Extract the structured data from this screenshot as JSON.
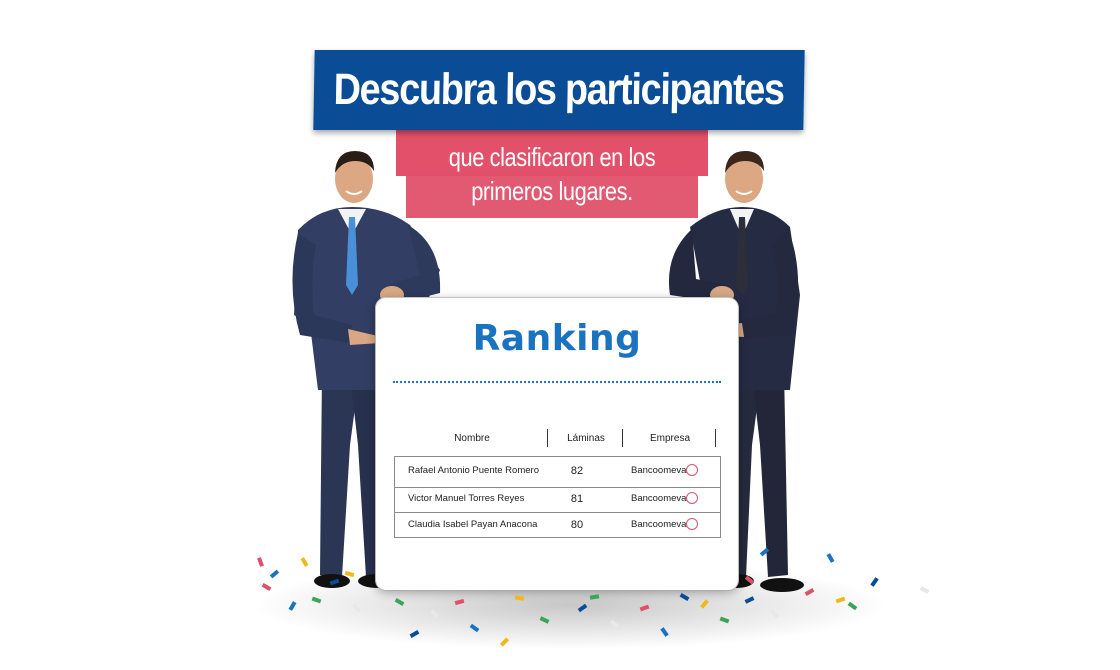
{
  "headline": {
    "title": "Descubra los participantes",
    "subtitle_line1": "que clasificaron en los",
    "subtitle_line2": "primeros lugares."
  },
  "board": {
    "title": "Ranking",
    "columns": [
      "Nombre",
      "Láminas",
      "Empresa"
    ],
    "rows": [
      {
        "name": "Rafael Antonio Puente Romero",
        "laminas": "82",
        "empresa": "Bancoomeva"
      },
      {
        "name": "Victor Manuel Torres Reyes",
        "laminas": "81",
        "empresa": "Bancoomeva"
      },
      {
        "name": "Claudia Isabel Payan Anacona",
        "laminas": "80",
        "empresa": "Bancoomeva"
      }
    ]
  },
  "colors": {
    "blue_banner": "#0a4d96",
    "pink_banner": "#e25069",
    "ranking_title": "#1a73c0",
    "suit": "#2e3a5c"
  }
}
